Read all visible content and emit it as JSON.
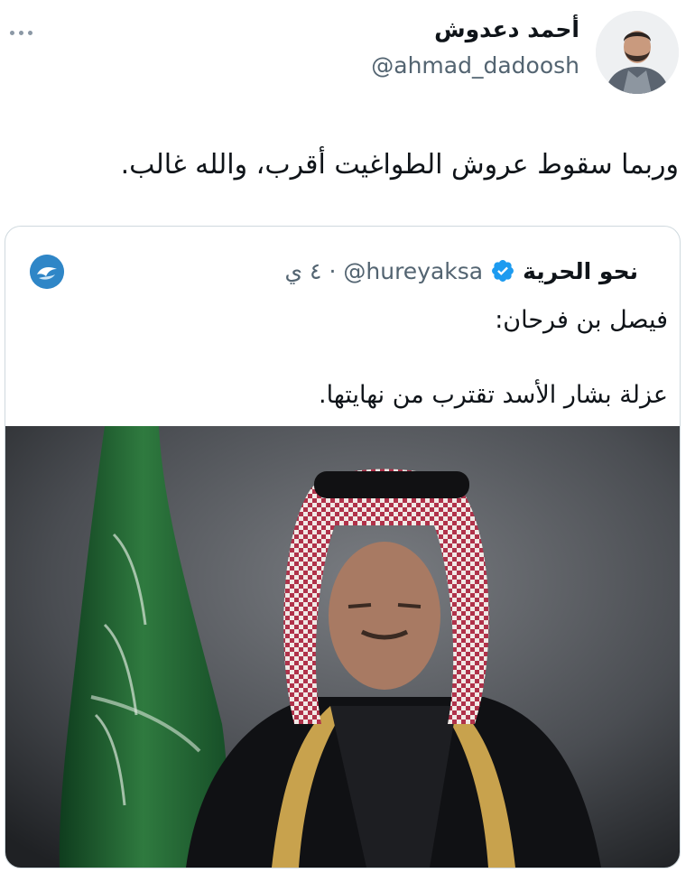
{
  "tweet": {
    "author_name": "أحمد دعدوش",
    "author_handle": "@ahmad_dadoosh",
    "text": "وربما سقوط عروش الطواغيت أقرب، والله غالب."
  },
  "quote": {
    "name": "نحو الحرية",
    "handle": "@hureyaksa",
    "separator": "·",
    "time": "٤ ي",
    "line1": "فيصل بن فرحان:",
    "line2": "عزلة بشار الأسد تقترب من نهايتها."
  },
  "icons": {
    "more": "more-horizontal-icon",
    "verified": "verified-badge-icon"
  },
  "colors": {
    "verified": "#1d9bf0",
    "secondary_text": "#536471",
    "border": "#cfd9de"
  }
}
